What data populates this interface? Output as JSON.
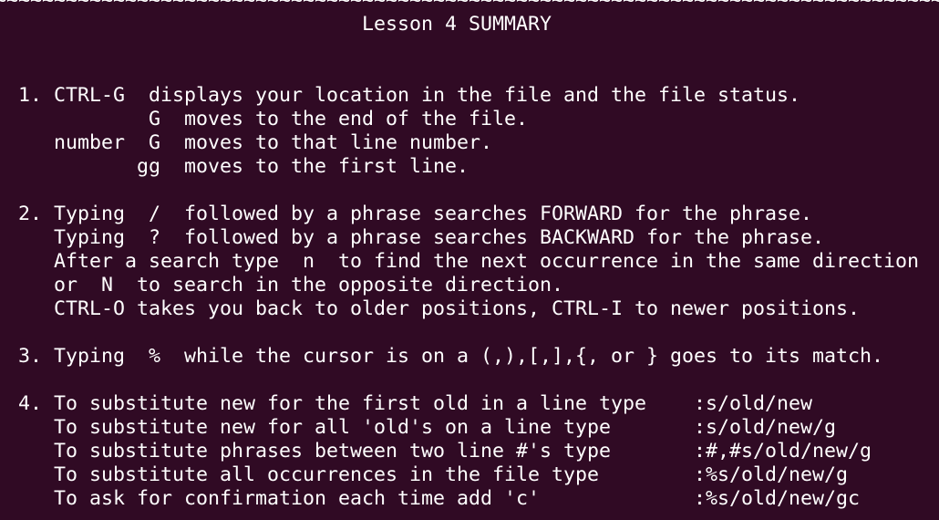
{
  "terminal": {
    "lines": [
      "~~~~~~~~~~~~~~~~~~~~~~~~~~~~~~~~~~~~~~~~~~~~~~~~~~~~~~~~~~~~~~~~~~~~~~~~~~~~~~~~",
      "                               Lesson 4 SUMMARY",
      "",
      "",
      "  1. CTRL-G  displays your location in the file and the file status.",
      "             G  moves to the end of the file.",
      "     number  G  moves to that line number.",
      "            gg  moves to the first line.",
      "",
      "  2. Typing  /  followed by a phrase searches FORWARD for the phrase.",
      "     Typing  ?  followed by a phrase searches BACKWARD for the phrase.",
      "     After a search type  n  to find the next occurrence in the same direction",
      "     or  N  to search in the opposite direction.",
      "     CTRL-O takes you back to older positions, CTRL-I to newer positions.",
      "",
      "  3. Typing  %  while the cursor is on a (,),[,],{, or } goes to its match.",
      "",
      "  4. To substitute new for the first old in a line type    :s/old/new",
      "     To substitute new for all 'old's on a line type       :s/old/new/g",
      "     To substitute phrases between two line #'s type       :#,#s/old/new/g",
      "     To substitute all occurrences in the file type        :%s/old/new/g",
      "     To ask for confirmation each time add 'c'             :%s/old/new/gc"
    ]
  }
}
